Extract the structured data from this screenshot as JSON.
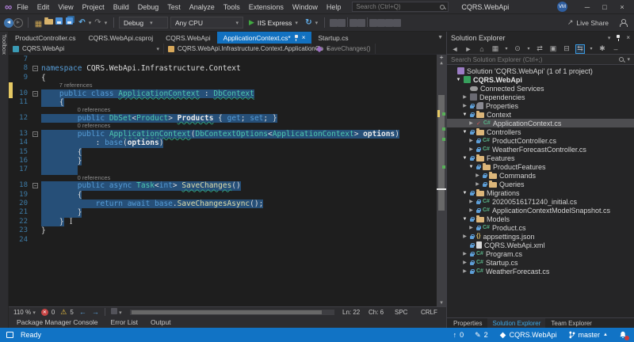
{
  "colors": {
    "accent": "#1173c5",
    "selection": "#264f78",
    "editor_bg": "#1e1e1e",
    "active_tab": "#1271c0",
    "changed_line_marker": "#e5c863"
  },
  "titlebar": {
    "menus": [
      "File",
      "Edit",
      "View",
      "Project",
      "Build",
      "Debug",
      "Test",
      "Analyze",
      "Tools",
      "Extensions",
      "Window",
      "Help"
    ],
    "search_placeholder": "Search (Ctrl+Q)",
    "title": "CQRS.WebApi",
    "avatar": "VM"
  },
  "toolbar": {
    "config": "Debug",
    "platform": "Any CPU",
    "run": "IIS Express",
    "live_share": "Live Share",
    "icon_groups": {
      "nav": [
        "navigate-back",
        "navigate-forward"
      ],
      "file": [
        "new-project",
        "open-folder",
        "save",
        "save-all"
      ],
      "edit": [
        "undo",
        "caret",
        "redo",
        "caret"
      ],
      "run_extra": [
        "refresh",
        "caret"
      ],
      "misc": [
        "feedback",
        "screenshot",
        "sep",
        "navigate-to",
        "find-in-files",
        "sep",
        "bookmark",
        "bookmark-prev",
        "bookmark-next",
        "bookmark-folder"
      ]
    }
  },
  "toolbox": {
    "label": "Toolbox"
  },
  "editor": {
    "tabs": [
      {
        "label": "ProductController.cs"
      },
      {
        "label": "CQRS.WebApi.csproj"
      },
      {
        "label": "CQRS.WebApi"
      },
      {
        "label": "ApplicationContext.cs*",
        "active": true
      },
      {
        "label": "Startup.cs"
      }
    ],
    "breadcrumb": {
      "project": "CQRS.WebApi",
      "type": "CQRS.WebApi.Infrastructure.Context.ApplicationCo",
      "member": "SaveChanges()"
    },
    "lines": [
      {
        "n": 7,
        "t": []
      },
      {
        "n": 8,
        "fold": 1,
        "t": [
          [
            "namespace ",
            "k"
          ],
          [
            "CQRS.WebApi.Infrastructure.Context",
            "p"
          ]
        ]
      },
      {
        "n": 9,
        "t": [
          [
            "{",
            "p"
          ]
        ]
      },
      {
        "lens": "7 references",
        "pad": 4,
        "mark": 1
      },
      {
        "n": 10,
        "fold": 1,
        "mark": 1,
        "sel": 1,
        "t": [
          [
            "    ",
            "p"
          ],
          [
            "public class ",
            "k"
          ],
          [
            "ApplicationContext",
            "t u"
          ],
          [
            " : ",
            "p"
          ],
          [
            "DbContext",
            "t u"
          ]
        ]
      },
      {
        "n": 11,
        "sel": 1,
        "t": [
          [
            "    {",
            "p"
          ]
        ]
      },
      {
        "lens": "0 references",
        "pad": 8
      },
      {
        "n": 12,
        "sel": 1,
        "t": [
          [
            "        ",
            "p"
          ],
          [
            "public ",
            "k"
          ],
          [
            "DbSet",
            "t"
          ],
          [
            "<",
            "p"
          ],
          [
            "Product",
            "t"
          ],
          [
            "> ",
            "p"
          ],
          [
            "Products",
            "b u"
          ],
          [
            " { ",
            "p"
          ],
          [
            "get",
            "k"
          ],
          [
            "; ",
            "p"
          ],
          [
            "set",
            "k"
          ],
          [
            "; }",
            "p"
          ]
        ]
      },
      {
        "lens": "0 references",
        "pad": 8
      },
      {
        "n": 13,
        "fold": 1,
        "sel": 1,
        "t": [
          [
            "        ",
            "p"
          ],
          [
            "public ",
            "k"
          ],
          [
            "ApplicationContext",
            "t u"
          ],
          [
            "(",
            "p"
          ],
          [
            "DbContextOptions",
            "t"
          ],
          [
            "<",
            "p"
          ],
          [
            "ApplicationContext",
            "t"
          ],
          [
            "> ",
            "p"
          ],
          [
            "options",
            "b"
          ],
          [
            ")",
            "p"
          ]
        ]
      },
      {
        "n": 14,
        "sel": 1,
        "t": [
          [
            "            : ",
            "p"
          ],
          [
            "base",
            "k"
          ],
          [
            "(",
            "p"
          ],
          [
            "options",
            "b"
          ],
          [
            ")",
            "p"
          ]
        ]
      },
      {
        "n": 15,
        "sel": 1,
        "t": [
          [
            "        {",
            "p"
          ]
        ]
      },
      {
        "n": 16,
        "sel": 1,
        "t": [
          [
            "        }",
            "p"
          ]
        ]
      },
      {
        "n": 17,
        "sel": 1,
        "t": [
          [
            "        ",
            "p"
          ]
        ]
      },
      {
        "lens": "0 references",
        "pad": 8
      },
      {
        "n": 18,
        "fold": 1,
        "sel": 1,
        "t": [
          [
            "        ",
            "p"
          ],
          [
            "public async ",
            "k"
          ],
          [
            "Task",
            "t"
          ],
          [
            "<",
            "p"
          ],
          [
            "int",
            "k"
          ],
          [
            "> ",
            "p"
          ],
          [
            "SaveChanges",
            "m u"
          ],
          [
            "()",
            "p"
          ]
        ]
      },
      {
        "n": 19,
        "sel": 1,
        "t": [
          [
            "        {",
            "p"
          ]
        ]
      },
      {
        "n": 20,
        "sel": 1,
        "t": [
          [
            "            ",
            "p"
          ],
          [
            "return ",
            "k"
          ],
          [
            "await ",
            "k"
          ],
          [
            "base",
            "k"
          ],
          [
            ".",
            "p"
          ],
          [
            "SaveChangesAsync",
            "m"
          ],
          [
            "();",
            "p"
          ]
        ]
      },
      {
        "n": 21,
        "sel": 1,
        "t": [
          [
            "        }",
            "p"
          ]
        ]
      },
      {
        "n": 22,
        "sel": 1,
        "caret": 1,
        "t": [
          [
            "    }",
            "p"
          ]
        ]
      },
      {
        "n": 23,
        "t": [
          [
            "}",
            "p"
          ]
        ]
      },
      {
        "n": 24,
        "t": []
      }
    ],
    "status": {
      "zoom": "110 %",
      "errors": "0",
      "warnings": "5",
      "ln": "Ln: 22",
      "col": "Ch: 6",
      "spc": "SPC",
      "eol": "CRLF"
    }
  },
  "bottom_panel": {
    "tabs": [
      "Package Manager Console",
      "Error List",
      "Output"
    ]
  },
  "solution_explorer": {
    "title": "Solution Explorer",
    "search_placeholder": "Search Solution Explorer (Ctrl+;)",
    "toolbar_icons": [
      "back",
      "forward",
      "home",
      "switch-views",
      "caret",
      "clock",
      "caret",
      "sync",
      "nest",
      "collapse-all",
      "sync-active-document",
      "caret",
      "properties",
      "dash"
    ],
    "items": [
      {
        "label": "Solution 'CQRS.WebApi' (1 of 1 project)",
        "indent": 0,
        "arrow": "none",
        "icon": "solution"
      },
      {
        "label": "CQRS.WebApi",
        "indent": 1,
        "arrow": "exp",
        "icon": "project",
        "bold": true
      },
      {
        "label": "Connected Services",
        "indent": 2,
        "arrow": "none",
        "icon": "cloud"
      },
      {
        "label": "Dependencies",
        "indent": 2,
        "arrow": "col",
        "icon": "deps"
      },
      {
        "label": "Properties",
        "indent": 2,
        "arrow": "col",
        "icon": "props",
        "lock": true
      },
      {
        "label": "Context",
        "indent": 2,
        "arrow": "exp",
        "icon": "folder",
        "lock": true
      },
      {
        "label": "ApplicationContext.cs",
        "indent": 3,
        "arrow": "col",
        "icon": "cs",
        "check": true,
        "selected": true
      },
      {
        "label": "Controllers",
        "indent": 2,
        "arrow": "exp",
        "icon": "folder",
        "lock": true
      },
      {
        "label": "ProductController.cs",
        "indent": 3,
        "arrow": "col",
        "icon": "cs",
        "lock": true
      },
      {
        "label": "WeatherForecastController.cs",
        "indent": 3,
        "arrow": "col",
        "icon": "cs",
        "lock": true
      },
      {
        "label": "Features",
        "indent": 2,
        "arrow": "exp",
        "icon": "folder",
        "lock": true
      },
      {
        "label": "ProductFeatures",
        "indent": 3,
        "arrow": "exp",
        "icon": "folder",
        "lock": true
      },
      {
        "label": "Commands",
        "indent": 4,
        "arrow": "col",
        "icon": "folder",
        "lock": true
      },
      {
        "label": "Queries",
        "indent": 4,
        "arrow": "col",
        "icon": "folder",
        "lock": true
      },
      {
        "label": "Migrations",
        "indent": 2,
        "arrow": "exp",
        "icon": "folder",
        "lock": true
      },
      {
        "label": "20200516171240_initial.cs",
        "indent": 3,
        "arrow": "col",
        "icon": "cs",
        "lock": true
      },
      {
        "label": "ApplicationContextModelSnapshot.cs",
        "indent": 3,
        "arrow": "col",
        "icon": "cs",
        "lock": true
      },
      {
        "label": "Models",
        "indent": 2,
        "arrow": "exp",
        "icon": "folder",
        "lock": true
      },
      {
        "label": "Product.cs",
        "indent": 3,
        "arrow": "col",
        "icon": "cs",
        "lock": true
      },
      {
        "label": "appsettings.json",
        "indent": 2,
        "arrow": "col",
        "icon": "json",
        "lock": true
      },
      {
        "label": "CQRS.WebApi.xml",
        "indent": 2,
        "arrow": "none",
        "icon": "xml",
        "lock": true
      },
      {
        "label": "Program.cs",
        "indent": 2,
        "arrow": "col",
        "icon": "cs",
        "lock": true
      },
      {
        "label": "Startup.cs",
        "indent": 2,
        "arrow": "col",
        "icon": "cs",
        "lock": true
      },
      {
        "label": "WeatherForecast.cs",
        "indent": 2,
        "arrow": "col",
        "icon": "cs",
        "lock": true
      }
    ],
    "bottom_tabs": [
      {
        "label": "Properties"
      },
      {
        "label": "Solution Explorer",
        "active": true
      },
      {
        "label": "Team Explorer"
      }
    ]
  },
  "statusbar": {
    "ready": "Ready",
    "pushes": "0",
    "edits": "2",
    "repo": "CQRS.WebApi",
    "branch": "master"
  }
}
